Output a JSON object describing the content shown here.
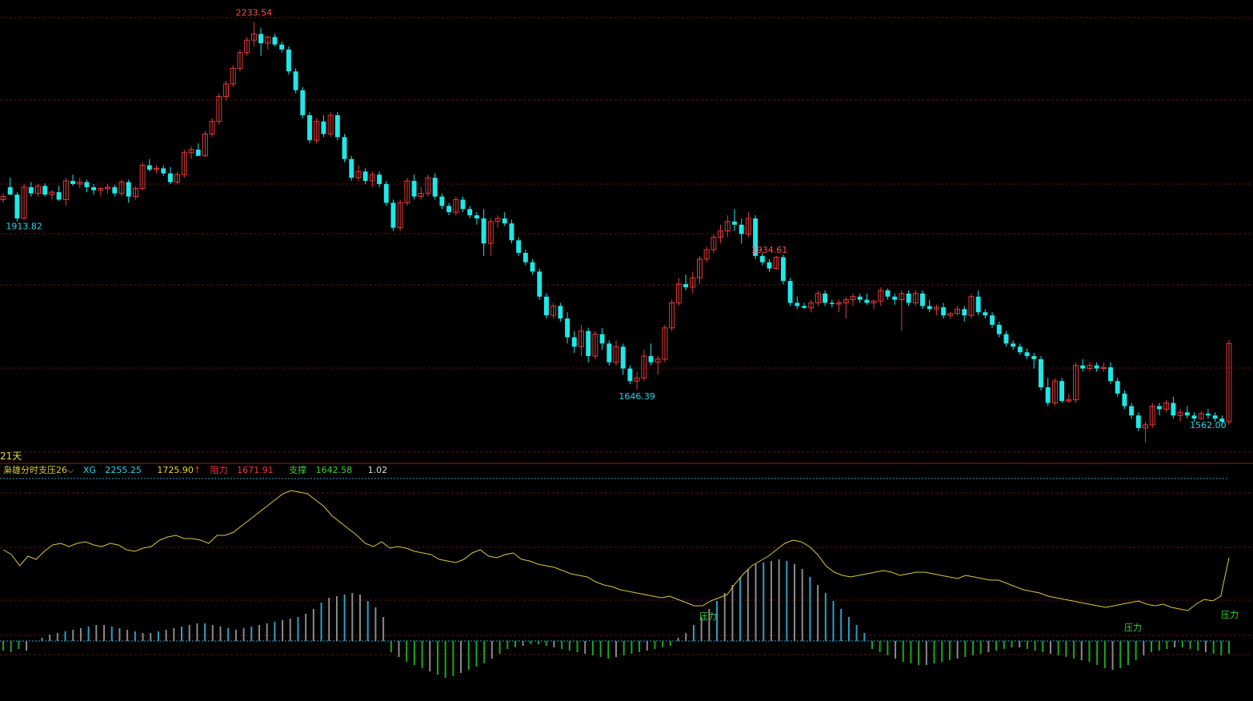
{
  "chart_data": {
    "type": "candlestick",
    "period_label": "21天",
    "price_labels": {
      "high": "2233.54",
      "low_left": "1913.82",
      "mid_high": "1934.61",
      "mid_low": "1646.39",
      "low_right": "1562.00"
    },
    "indicator": {
      "name": "枭雄分时支压26",
      "xg_label": "XG",
      "xg_value": "2255.25",
      "value2": "1725.90",
      "resist_label": "阻力",
      "resist_value": "1671.91",
      "support_label": "支撑",
      "support_value": "1642.58",
      "value5": "1.02",
      "annotations": [
        "压力",
        "压力",
        "压力"
      ]
    },
    "price_range": [
      1540,
      2250
    ],
    "candles": [
      [
        1950,
        1960,
        1945,
        1955
      ],
      [
        1970,
        1985,
        1965,
        1958
      ],
      [
        1958,
        1962,
        1915,
        1920
      ],
      [
        1920,
        1975,
        1918,
        1970
      ],
      [
        1970,
        1978,
        1955,
        1960
      ],
      [
        1960,
        1975,
        1955,
        1972
      ],
      [
        1972,
        1976,
        1955,
        1958
      ],
      [
        1958,
        1965,
        1950,
        1962
      ],
      [
        1962,
        1972,
        1948,
        1950
      ],
      [
        1950,
        1985,
        1940,
        1980
      ],
      [
        1980,
        1990,
        1972,
        1975
      ],
      [
        1975,
        1985,
        1968,
        1978
      ],
      [
        1978,
        1982,
        1962,
        1970
      ],
      [
        1970,
        1975,
        1958,
        1965
      ],
      [
        1965,
        1970,
        1955,
        1968
      ],
      [
        1968,
        1975,
        1960,
        1970
      ],
      [
        1970,
        1974,
        1955,
        1960
      ],
      [
        1960,
        1982,
        1955,
        1978
      ],
      [
        1978,
        1982,
        1945,
        1955
      ],
      [
        1955,
        1972,
        1950,
        1968
      ],
      [
        1968,
        2010,
        1965,
        2005
      ],
      [
        2005,
        2015,
        1995,
        1998
      ],
      [
        1998,
        2005,
        1992,
        2000
      ],
      [
        2000,
        2005,
        1988,
        1992
      ],
      [
        1992,
        2002,
        1975,
        1978
      ],
      [
        1978,
        1995,
        1975,
        1990
      ],
      [
        1990,
        2030,
        1985,
        2025
      ],
      [
        2025,
        2035,
        2015,
        2030
      ],
      [
        2030,
        2040,
        2020,
        2020
      ],
      [
        2020,
        2060,
        2018,
        2055
      ],
      [
        2055,
        2080,
        2050,
        2075
      ],
      [
        2075,
        2120,
        2070,
        2115
      ],
      [
        2115,
        2140,
        2108,
        2135
      ],
      [
        2135,
        2165,
        2130,
        2160
      ],
      [
        2160,
        2190,
        2155,
        2185
      ],
      [
        2185,
        2210,
        2180,
        2205
      ],
      [
        2205,
        2234,
        2195,
        2215
      ],
      [
        2215,
        2225,
        2180,
        2200
      ],
      [
        2200,
        2212,
        2190,
        2210
      ],
      [
        2210,
        2215,
        2195,
        2198
      ],
      [
        2198,
        2203,
        2185,
        2190
      ],
      [
        2190,
        2195,
        2150,
        2155
      ],
      [
        2155,
        2160,
        2120,
        2125
      ],
      [
        2125,
        2130,
        2080,
        2085
      ],
      [
        2085,
        2090,
        2040,
        2045
      ],
      [
        2045,
        2080,
        2040,
        2075
      ],
      [
        2075,
        2085,
        2050,
        2055
      ],
      [
        2055,
        2090,
        2050,
        2085
      ],
      [
        2085,
        2090,
        2045,
        2050
      ],
      [
        2050,
        2055,
        2010,
        2015
      ],
      [
        2015,
        2020,
        1980,
        1985
      ],
      [
        1985,
        2005,
        1980,
        1995
      ],
      [
        1995,
        2000,
        1975,
        1980
      ],
      [
        1980,
        1995,
        1970,
        1990
      ],
      [
        1990,
        1995,
        1970,
        1975
      ],
      [
        1975,
        1980,
        1940,
        1945
      ],
      [
        1945,
        1950,
        1900,
        1905
      ],
      [
        1905,
        1950,
        1900,
        1945
      ],
      [
        1945,
        1985,
        1940,
        1980
      ],
      [
        1980,
        1990,
        1950,
        1955
      ],
      [
        1955,
        1970,
        1950,
        1960
      ],
      [
        1960,
        1990,
        1955,
        1985
      ],
      [
        1985,
        1992,
        1950,
        1955
      ],
      [
        1955,
        1960,
        1935,
        1940
      ],
      [
        1940,
        1945,
        1925,
        1930
      ],
      [
        1930,
        1955,
        1925,
        1950
      ],
      [
        1950,
        1955,
        1930,
        1935
      ],
      [
        1935,
        1940,
        1920,
        1925
      ],
      [
        1925,
        1930,
        1910,
        1920
      ],
      [
        1920,
        1935,
        1860,
        1880
      ],
      [
        1880,
        1920,
        1860,
        1915
      ],
      [
        1915,
        1925,
        1905,
        1920
      ],
      [
        1920,
        1930,
        1908,
        1912
      ],
      [
        1912,
        1918,
        1880,
        1885
      ],
      [
        1885,
        1890,
        1860,
        1865
      ],
      [
        1865,
        1870,
        1845,
        1850
      ],
      [
        1850,
        1855,
        1830,
        1835
      ],
      [
        1835,
        1840,
        1790,
        1795
      ],
      [
        1795,
        1800,
        1760,
        1765
      ],
      [
        1765,
        1785,
        1760,
        1780
      ],
      [
        1780,
        1785,
        1755,
        1760
      ],
      [
        1760,
        1770,
        1720,
        1730
      ],
      [
        1730,
        1740,
        1705,
        1715
      ],
      [
        1715,
        1750,
        1700,
        1740
      ],
      [
        1740,
        1745,
        1690,
        1700
      ],
      [
        1700,
        1740,
        1695,
        1735
      ],
      [
        1735,
        1745,
        1710,
        1720
      ],
      [
        1720,
        1725,
        1685,
        1690
      ],
      [
        1690,
        1725,
        1685,
        1715
      ],
      [
        1715,
        1720,
        1670,
        1680
      ],
      [
        1680,
        1685,
        1655,
        1660
      ],
      [
        1660,
        1675,
        1646,
        1665
      ],
      [
        1665,
        1710,
        1660,
        1700
      ],
      [
        1700,
        1720,
        1685,
        1690
      ],
      [
        1690,
        1700,
        1670,
        1695
      ],
      [
        1695,
        1750,
        1690,
        1745
      ],
      [
        1745,
        1790,
        1740,
        1785
      ],
      [
        1785,
        1825,
        1780,
        1815
      ],
      [
        1815,
        1830,
        1805,
        1810
      ],
      [
        1810,
        1835,
        1800,
        1825
      ],
      [
        1825,
        1860,
        1815,
        1855
      ],
      [
        1855,
        1875,
        1850,
        1870
      ],
      [
        1870,
        1895,
        1865,
        1890
      ],
      [
        1890,
        1910,
        1880,
        1900
      ],
      [
        1900,
        1925,
        1890,
        1915
      ],
      [
        1915,
        1935,
        1900,
        1910
      ],
      [
        1910,
        1920,
        1880,
        1895
      ],
      [
        1895,
        1930,
        1890,
        1920
      ],
      [
        1920,
        1925,
        1855,
        1860
      ],
      [
        1860,
        1865,
        1845,
        1850
      ],
      [
        1850,
        1855,
        1835,
        1840
      ],
      [
        1840,
        1860,
        1838,
        1858
      ],
      [
        1858,
        1862,
        1815,
        1820
      ],
      [
        1820,
        1825,
        1780,
        1785
      ],
      [
        1785,
        1795,
        1775,
        1780
      ],
      [
        1780,
        1785,
        1775,
        1777
      ],
      [
        1777,
        1790,
        1770,
        1785
      ],
      [
        1785,
        1805,
        1780,
        1800
      ],
      [
        1800,
        1805,
        1780,
        1785
      ],
      [
        1785,
        1790,
        1778,
        1783
      ],
      [
        1783,
        1790,
        1770,
        1785
      ],
      [
        1785,
        1795,
        1760,
        1790
      ],
      [
        1790,
        1800,
        1780,
        1795
      ],
      [
        1795,
        1800,
        1785,
        1790
      ],
      [
        1790,
        1800,
        1782,
        1785
      ],
      [
        1785,
        1790,
        1775,
        1788
      ],
      [
        1788,
        1810,
        1780,
        1805
      ],
      [
        1805,
        1808,
        1790,
        1795
      ],
      [
        1795,
        1800,
        1782,
        1790
      ],
      [
        1790,
        1805,
        1740,
        1800
      ],
      [
        1800,
        1805,
        1780,
        1785
      ],
      [
        1785,
        1805,
        1780,
        1800
      ],
      [
        1800,
        1805,
        1775,
        1780
      ],
      [
        1780,
        1790,
        1770,
        1775
      ],
      [
        1775,
        1782,
        1765,
        1778
      ],
      [
        1778,
        1785,
        1760,
        1765
      ],
      [
        1765,
        1770,
        1760,
        1768
      ],
      [
        1768,
        1780,
        1765,
        1775
      ],
      [
        1775,
        1780,
        1755,
        1765
      ],
      [
        1765,
        1800,
        1760,
        1795
      ],
      [
        1795,
        1805,
        1765,
        1770
      ],
      [
        1770,
        1775,
        1760,
        1765
      ],
      [
        1765,
        1770,
        1745,
        1750
      ],
      [
        1750,
        1755,
        1730,
        1735
      ],
      [
        1735,
        1740,
        1715,
        1720
      ],
      [
        1720,
        1725,
        1710,
        1715
      ],
      [
        1715,
        1720,
        1702,
        1706
      ],
      [
        1706,
        1712,
        1695,
        1700
      ],
      [
        1700,
        1705,
        1680,
        1695
      ],
      [
        1695,
        1700,
        1645,
        1650
      ],
      [
        1650,
        1665,
        1620,
        1625
      ],
      [
        1625,
        1665,
        1620,
        1660
      ],
      [
        1660,
        1665,
        1625,
        1628
      ],
      [
        1628,
        1640,
        1625,
        1630
      ],
      [
        1630,
        1690,
        1625,
        1685
      ],
      [
        1685,
        1695,
        1675,
        1680
      ],
      [
        1680,
        1690,
        1675,
        1685
      ],
      [
        1685,
        1690,
        1675,
        1680
      ],
      [
        1680,
        1690,
        1675,
        1682
      ],
      [
        1682,
        1690,
        1655,
        1660
      ],
      [
        1660,
        1665,
        1635,
        1640
      ],
      [
        1640,
        1645,
        1615,
        1620
      ],
      [
        1620,
        1625,
        1600,
        1605
      ],
      [
        1605,
        1610,
        1580,
        1585
      ],
      [
        1585,
        1595,
        1562,
        1590
      ],
      [
        1590,
        1625,
        1585,
        1620
      ],
      [
        1620,
        1625,
        1605,
        1615
      ],
      [
        1615,
        1630,
        1610,
        1625
      ],
      [
        1625,
        1635,
        1600,
        1605
      ],
      [
        1605,
        1615,
        1595,
        1610
      ],
      [
        1610,
        1620,
        1600,
        1605
      ],
      [
        1605,
        1610,
        1595,
        1600
      ],
      [
        1600,
        1612,
        1598,
        1608
      ],
      [
        1608,
        1615,
        1600,
        1605
      ],
      [
        1605,
        1610,
        1595,
        1600
      ],
      [
        1600,
        1605,
        1590,
        1595
      ],
      [
        1595,
        1725,
        1590,
        1720
      ]
    ],
    "osc_line": [
      78,
      72,
      58,
      70,
      66,
      76,
      84,
      86,
      82,
      86,
      88,
      84,
      82,
      86,
      84,
      78,
      76,
      80,
      82,
      90,
      94,
      96,
      92,
      92,
      90,
      86,
      96,
      96,
      100,
      108,
      116,
      124,
      132,
      140,
      148,
      152,
      150,
      148,
      140,
      132,
      120,
      112,
      104,
      96,
      86,
      82,
      88,
      80,
      82,
      80,
      76,
      74,
      72,
      66,
      64,
      62,
      66,
      74,
      78,
      70,
      68,
      72,
      74,
      66,
      64,
      60,
      58,
      56,
      52,
      48,
      46,
      44,
      38,
      34,
      32,
      28,
      26,
      24,
      22,
      20,
      18,
      20,
      16,
      12,
      8,
      8,
      14,
      18,
      22,
      36,
      48,
      58,
      64,
      70,
      78,
      86,
      90,
      88,
      82,
      72,
      58,
      50,
      46,
      44,
      46,
      48,
      50,
      52,
      50,
      46,
      48,
      50,
      50,
      48,
      46,
      44,
      42,
      46,
      44,
      42,
      40,
      40,
      36,
      32,
      28,
      26,
      24,
      20,
      18,
      16,
      14,
      12,
      10,
      8,
      6,
      8,
      10,
      12,
      14,
      10,
      8,
      10,
      6,
      4,
      2,
      10,
      16,
      14,
      20,
      68
    ],
    "osc_bars": [
      -12,
      -14,
      -10,
      -12,
      0,
      4,
      8,
      10,
      12,
      14,
      16,
      18,
      20,
      20,
      18,
      16,
      14,
      12,
      10,
      10,
      12,
      14,
      16,
      18,
      20,
      22,
      22,
      20,
      18,
      16,
      14,
      16,
      18,
      20,
      22,
      24,
      26,
      28,
      30,
      34,
      40,
      48,
      54,
      56,
      58,
      60,
      58,
      50,
      42,
      30,
      -14,
      -20,
      -26,
      -30,
      -34,
      -38,
      -42,
      -46,
      -44,
      -40,
      -36,
      -32,
      -28,
      -22,
      -16,
      -10,
      -8,
      -6,
      -4,
      -4,
      -6,
      -8,
      -10,
      -12,
      -14,
      -16,
      -18,
      -20,
      -22,
      -20,
      -18,
      -16,
      -14,
      -12,
      -10,
      -8,
      -6,
      4,
      10,
      20,
      30,
      40,
      50,
      60,
      70,
      80,
      90,
      96,
      98,
      100,
      102,
      100,
      96,
      90,
      80,
      70,
      60,
      50,
      40,
      30,
      20,
      10,
      -10,
      -14,
      -18,
      -22,
      -26,
      -28,
      -30,
      -30,
      -28,
      -26,
      -24,
      -22,
      -20,
      -18,
      -16,
      -14,
      -12,
      -10,
      -8,
      -8,
      -10,
      -12,
      -14,
      -16,
      -18,
      -20,
      -22,
      -24,
      -26,
      -30,
      -34,
      -36,
      -34,
      -30,
      -24,
      -18,
      -14,
      -12,
      -10,
      -8,
      -8,
      -10,
      -12,
      -14,
      -16,
      -18,
      -16
    ],
    "colors": {
      "bg": "#000000",
      "up": "#e23a3a",
      "down": "#1ee8e8",
      "grid": "#6a1010",
      "label_up": "#ff4d4d",
      "label_down": "#23d8ea",
      "osc_line": "#d8c83c",
      "bar_pos_grey": "#8a8a8a",
      "bar_pos_blue": "#2aa0c8",
      "bar_neg_green": "#1aa81a",
      "divider": "#9a1a1a",
      "dotted": "#2aa0c8",
      "legend_name": "#d8c83c",
      "legend_xg": "#23d8ea",
      "legend_v2": "#f0d820",
      "legend_resist": "#ff3030",
      "legend_support": "#30d830",
      "legend_v5": "#dddddd",
      "annot": "#30d830"
    }
  }
}
